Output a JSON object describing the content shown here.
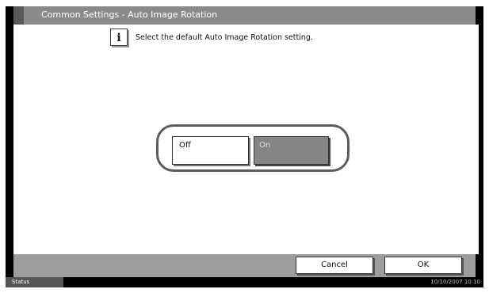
{
  "header": {
    "title": "Common Settings - Auto Image Rotation"
  },
  "message": {
    "icon": "info-icon",
    "text": "Select the default Auto Image Rotation setting."
  },
  "options": {
    "off_label": "Off",
    "on_label": "On",
    "selected": "On"
  },
  "footer": {
    "cancel_label": "Cancel",
    "ok_label": "OK"
  },
  "statusbar": {
    "status_label": "Status",
    "datetime": "10/10/2007   10:10"
  }
}
